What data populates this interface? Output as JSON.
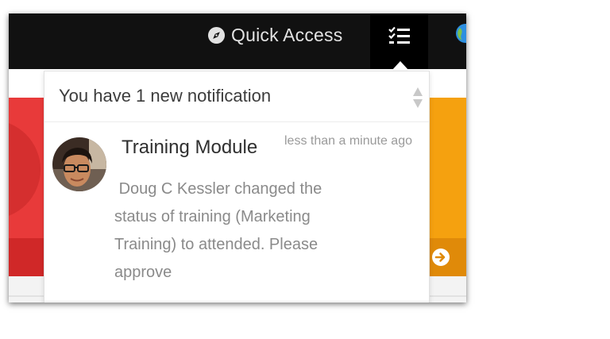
{
  "header": {
    "quick_access_label": "Quick Access",
    "quick_access_icon": "compass-icon",
    "tasks_icon": "checklist-icon",
    "globe_icon": "globe-icon"
  },
  "notifications": {
    "summary": "You have 1 new notification",
    "items": [
      {
        "module": "Training Module",
        "time": "less than a minute ago",
        "message": " Doug C Kessler changed the status of training (Marketing Training) to attended. Please approve",
        "avatar_icon": "user-avatar"
      }
    ]
  },
  "colors": {
    "topbar": "#111111",
    "tile_red": "#e83a3a",
    "tile_orange": "#f5a10f"
  }
}
